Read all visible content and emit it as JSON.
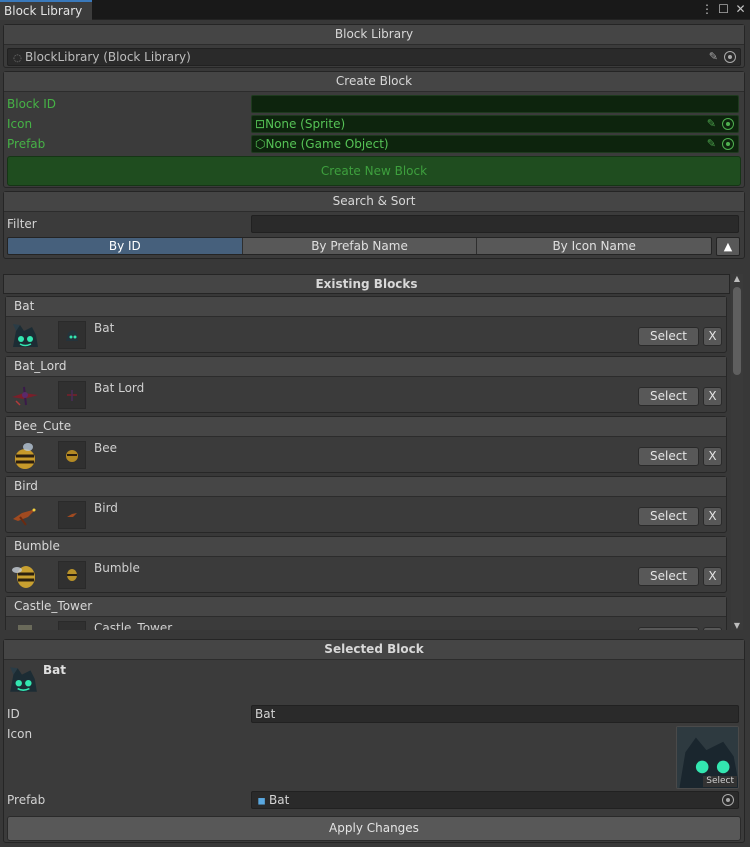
{
  "window": {
    "tab_title": "Block Library",
    "menu_icon": "kebab-menu-icon",
    "maximize_icon": "maximize-icon",
    "close_icon": "close-icon"
  },
  "library": {
    "header": "Block Library",
    "asset_value": "BlockLibrary (Block Library)"
  },
  "create": {
    "header": "Create Block",
    "id_label": "Block ID",
    "id_value": "",
    "icon_label": "Icon",
    "icon_value": "None (Sprite)",
    "prefab_label": "Prefab",
    "prefab_value": "None (Game Object)",
    "button": "Create New Block"
  },
  "search": {
    "header": "Search & Sort",
    "filter_label": "Filter",
    "filter_value": "",
    "sort_options": [
      "By ID",
      "By Prefab Name",
      "By Icon Name"
    ],
    "active_sort": "By ID",
    "direction_icon": "ascending-arrow-icon"
  },
  "existing": {
    "header": "Existing Blocks",
    "select_label": "Select",
    "remove_label": "X",
    "blocks": [
      {
        "id": "Bat",
        "name": "Bat"
      },
      {
        "id": "Bat_Lord",
        "name": "Bat Lord"
      },
      {
        "id": "Bee_Cute",
        "name": "Bee"
      },
      {
        "id": "Bird",
        "name": "Bird"
      },
      {
        "id": "Bumble",
        "name": "Bumble"
      },
      {
        "id": "Castle_Tower",
        "name": "Castle_Tower"
      }
    ]
  },
  "selected": {
    "header": "Selected Block",
    "title": "Bat",
    "id_label": "ID",
    "id_value": "Bat",
    "icon_label": "Icon",
    "preview_select": "Select",
    "prefab_label": "Prefab",
    "prefab_value": "Bat",
    "apply_button": "Apply Changes"
  },
  "colors": {
    "accent_green": "#46b246",
    "active_sort_bg": "#46607c",
    "create_button_bg": "#1f4d1f"
  }
}
